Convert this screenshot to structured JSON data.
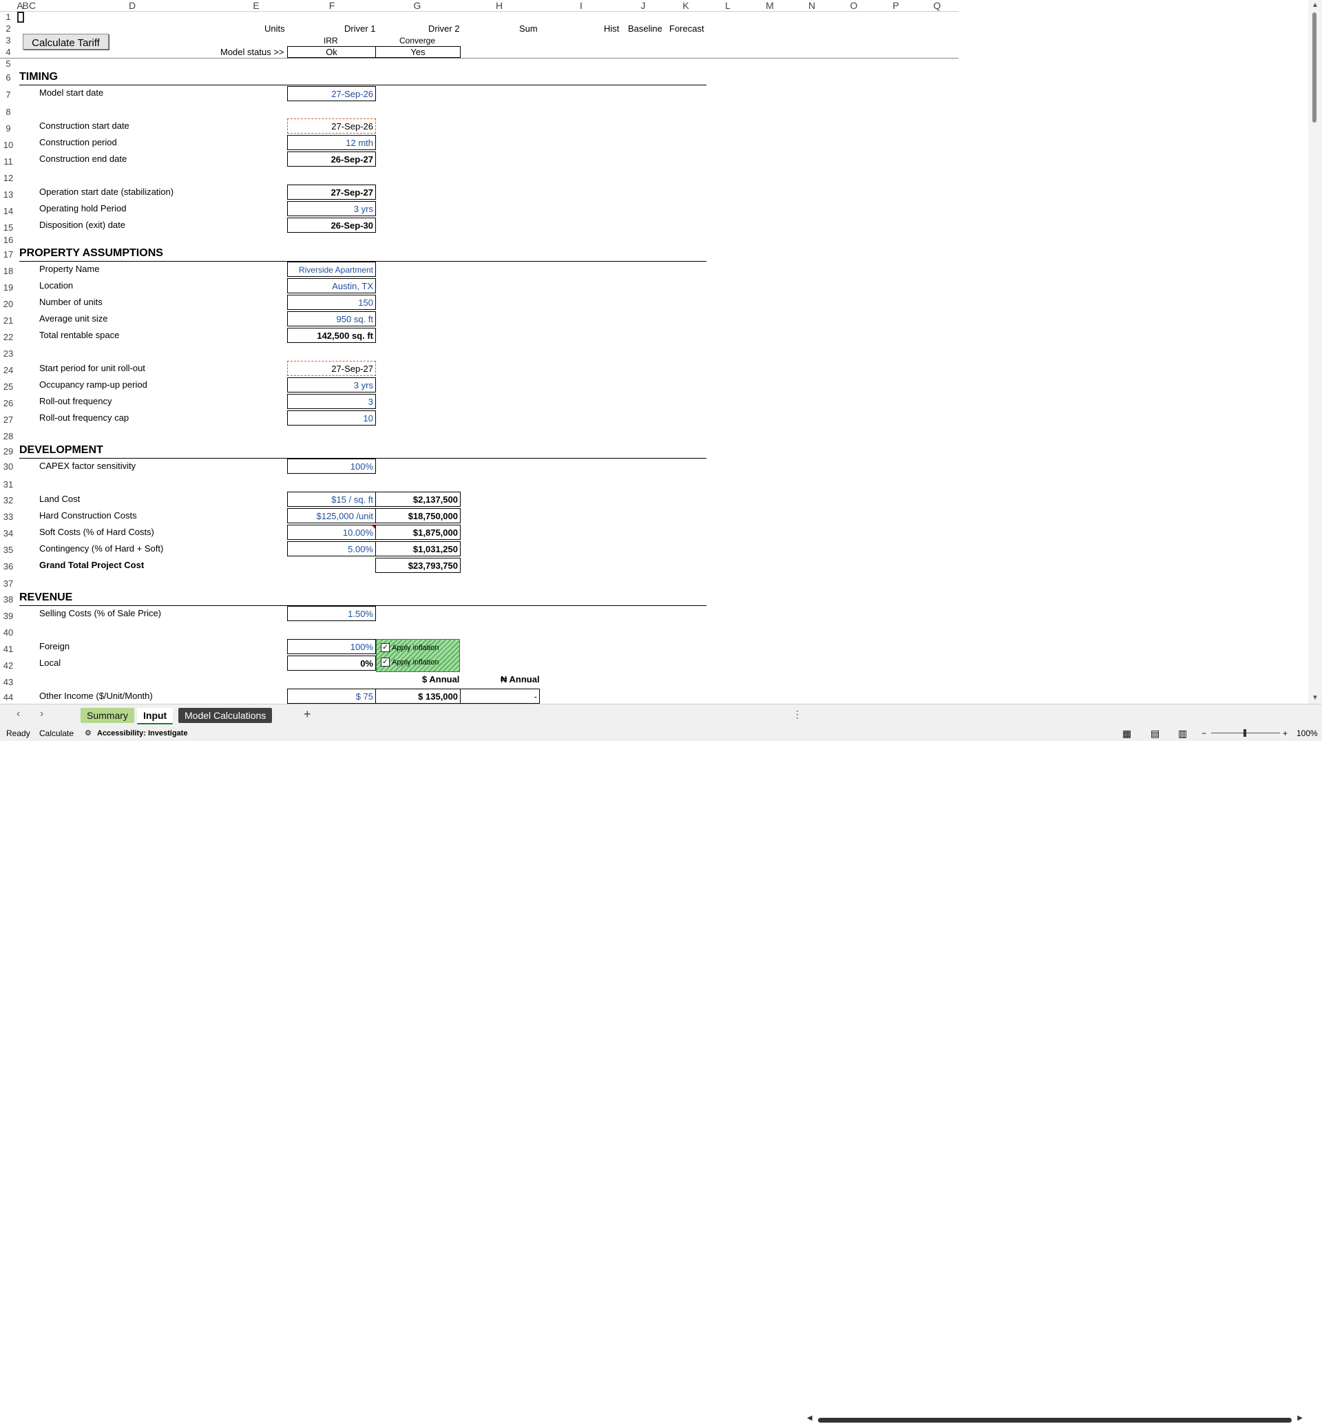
{
  "columns": [
    "A",
    "B",
    "C",
    "D",
    "E",
    "F",
    "G",
    "H",
    "I",
    "J",
    "K",
    "L",
    "M",
    "N",
    "O",
    "P",
    "Q"
  ],
  "header_row": {
    "units": "Units",
    "driver1": "Driver 1",
    "driver2": "Driver 2",
    "sum": "Sum",
    "hist": "Hist",
    "baseline": "Baseline",
    "forecast": "Forecast",
    "irr": "IRR",
    "converge": "Converge",
    "model_status_label": "Model status >>",
    "model_status_value": "Ok",
    "converge_value": "Yes"
  },
  "button": {
    "calculate": "Calculate Tariff"
  },
  "sections": {
    "timing": "TIMING",
    "property": "PROPERTY ASSUMPTIONS",
    "development": "DEVELOPMENT",
    "revenue": "REVENUE"
  },
  "rows": {
    "model_start_label": "Model start date",
    "model_start": "27-Sep-26",
    "cons_start_label": "Construction start date",
    "cons_start": "27-Sep-26",
    "cons_period_label": "Construction period",
    "cons_period": "12 mth",
    "cons_end_label": "Construction end date",
    "cons_end": "26-Sep-27",
    "op_start_label": "Operation start date (stabilization)",
    "op_start": "27-Sep-27",
    "hold_label": "Operating hold Period",
    "hold": "3 yrs",
    "exit_label": "Disposition (exit) date",
    "exit": "26-Sep-30",
    "prop_name_label": "Property Name",
    "prop_name": "Riverside Apartment",
    "location_label": "Location",
    "location": "Austin, TX",
    "units_label": "Number of units",
    "units": "150",
    "avg_size_label": "Average unit size",
    "avg_size": "950 sq. ft",
    "total_space_label": "Total rentable space",
    "total_space": "142,500 sq. ft",
    "rollout_start_label": "Start period for unit roll-out",
    "rollout_start": "27-Sep-27",
    "rampup_label": "Occupancy ramp-up period",
    "rampup": "3 yrs",
    "rollout_freq_label": "Roll-out frequency",
    "rollout_freq": "3",
    "rollout_cap_label": "Roll-out frequency cap",
    "rollout_cap": "10",
    "capex_label": "CAPEX factor sensitivity",
    "capex": "100%",
    "land_label": "Land Cost",
    "land_rate": "$15 / sq. ft",
    "land_total": "$2,137,500",
    "hard_label": "Hard Construction Costs",
    "hard_rate": "$125,000 /unit",
    "hard_total": "$18,750,000",
    "soft_label": "Soft Costs (% of Hard Costs)",
    "soft_rate": "10.00%",
    "soft_total": "$1,875,000",
    "cont_label": "Contingency (% of Hard + Soft)",
    "cont_rate": "5.00%",
    "cont_total": "$1,031,250",
    "grand_label": "Grand Total Project Cost",
    "grand_total": "$23,793,750",
    "selling_label": "Selling Costs (% of Sale Price)",
    "selling": "1.50%",
    "foreign_label": "Foreign",
    "foreign": "100%",
    "local_label": "Local",
    "local": "0%",
    "apply_inflation": "Apply inflation",
    "usd_annual": "$ Annual",
    "ngn_annual": "₦ Annual",
    "other_income_label": "Other Income ($/Unit/Month)",
    "other_income": "$ 75",
    "other_income_usd": "$ 135,000",
    "other_income_ngn": "-"
  },
  "row_numbers": [
    "1",
    "2",
    "3",
    "4",
    "5",
    "6",
    "7",
    "8",
    "9",
    "10",
    "11",
    "12",
    "13",
    "14",
    "15",
    "16",
    "17",
    "18",
    "19",
    "20",
    "21",
    "22",
    "23",
    "24",
    "25",
    "26",
    "27",
    "28",
    "29",
    "30",
    "31",
    "32",
    "33",
    "34",
    "35",
    "36",
    "37",
    "38",
    "39",
    "40",
    "41",
    "42",
    "43",
    "44"
  ],
  "tabs": [
    "Summary",
    "Input",
    "Model Calculations"
  ],
  "add_tab": "+",
  "status": {
    "ready": "Ready",
    "calculate": "Calculate",
    "accessibility": "Accessibility: Investigate",
    "zoom": "100%"
  },
  "colors": {
    "tab_summary": "#b5d98c",
    "tab_model_calc": "#404040",
    "input_blue": "#1f4e9c"
  }
}
